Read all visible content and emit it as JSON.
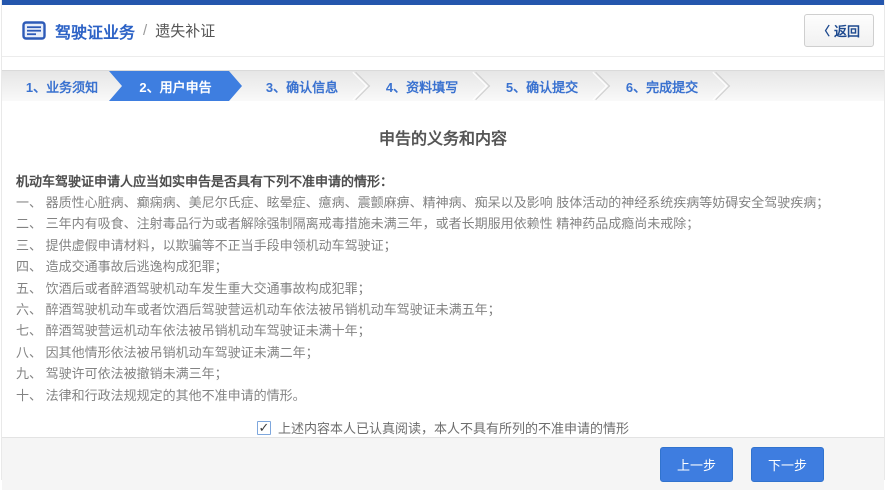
{
  "header": {
    "app_title": "驾驶证业务",
    "separator": "/",
    "page_title": "遗失补证",
    "back_label": "返回"
  },
  "icons": {
    "back_chevron": "〈",
    "license_icon": "card-with-lines",
    "checkbox_check": "✓"
  },
  "steps": [
    {
      "label": "1、业务须知",
      "active": false
    },
    {
      "label": "2、用户申告",
      "active": true
    },
    {
      "label": "3、确认信息",
      "active": false
    },
    {
      "label": "4、资料填写",
      "active": false
    },
    {
      "label": "5、确认提交",
      "active": false
    },
    {
      "label": "6、完成提交",
      "active": false
    }
  ],
  "content": {
    "title": "申告的义务和内容",
    "intro": "机动车驾驶证申请人应当如实申告是否具有下列不准申请的情形：",
    "items": [
      "一、 器质性心脏病、癫痫病、美尼尔氏症、眩晕症、癔病、震颤麻痹、精神病、痴呆以及影响 肢体活动的神经系统疾病等妨碍安全驾驶疾病；",
      "二、 三年内有吸食、注射毒品行为或者解除强制隔离戒毒措施未满三年，或者长期服用依赖性 精神药品成瘾尚未戒除；",
      "三、 提供虚假申请材料，以欺骗等不正当手段申领机动车驾驶证；",
      "四、 造成交通事故后逃逸构成犯罪；",
      "五、 饮酒后或者醉酒驾驶机动车发生重大交通事故构成犯罪；",
      "六、 醉酒驾驶机动车或者饮酒后驾驶营运机动车依法被吊销机动车驾驶证未满五年；",
      "七、 醉酒驾驶营运机动车依法被吊销机动车驾驶证未满十年；",
      "八、 因其他情形依法被吊销机动车驾驶证未满二年；",
      "九、 驾驶许可依法被撤销未满三年；",
      "十、 法律和行政法规规定的其他不准申请的情形。"
    ],
    "checkbox_checked": true,
    "checkbox_label": "上述内容本人已认真阅读，本人不具有所列的不准申请的情形"
  },
  "footer": {
    "prev_label": "上一步",
    "next_label": "下一步"
  },
  "colors": {
    "topbar_blue": "#2456ad",
    "title_blue": "#2c62c6",
    "step_text_blue": "#3a72d0",
    "active_step_blue": "#3e7ee0",
    "button_blue": "#3e7de0",
    "body_text_gray": "#838383"
  }
}
